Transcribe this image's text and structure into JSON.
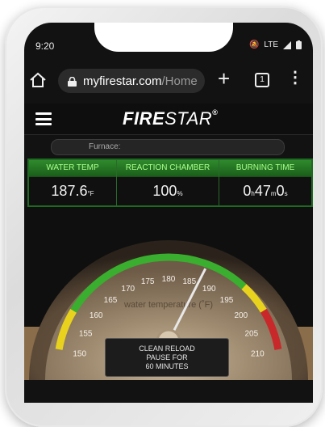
{
  "status_bar": {
    "time": "9:20",
    "network": "LTE"
  },
  "browser": {
    "url_host": "myfirestar.com",
    "url_path": "/Home",
    "tab_count": "1"
  },
  "app": {
    "logo_part1": "FIRE",
    "logo_part2": "STAR",
    "logo_mark": "®"
  },
  "furnace": {
    "label": "Furnace:"
  },
  "stats": {
    "water_temp": {
      "label": "WATER TEMP",
      "value": "187.6",
      "unit": "°F"
    },
    "reaction_chamber": {
      "label": "REACTION CHAMBER",
      "value": "100",
      "unit": "%"
    },
    "burning_time": {
      "label": "BURNING TIME",
      "hours": "0",
      "h_unit": "h",
      "minutes": "47",
      "m_unit": "m",
      "seconds": "0",
      "s_unit": "s"
    }
  },
  "gauge": {
    "label": "water temperature (˚F)",
    "ticks": [
      "150",
      "155",
      "160",
      "165",
      "170",
      "175",
      "180",
      "185",
      "190",
      "195",
      "200",
      "205",
      "210"
    ],
    "min": 150,
    "max": 210,
    "value": 187.6,
    "colors": {
      "yellow": "#e8d21e",
      "green": "#3aae2e",
      "red": "#c8282a",
      "needle": "#e8e8e8"
    }
  },
  "clean_reload": {
    "line1": "CLEAN RELOAD",
    "line2": "PAUSE FOR",
    "line3": "60 MINUTES"
  }
}
